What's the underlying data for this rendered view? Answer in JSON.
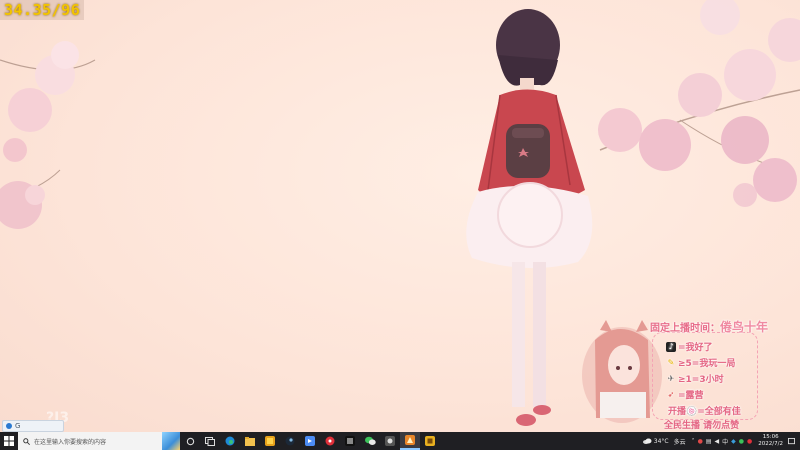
{
  "overlay_fps": "34.35/96",
  "toast": {
    "text": "G"
  },
  "ghost_mark": "?J3",
  "stream_overlay": {
    "title_prefix": "固定上播时间：",
    "title_highlight": "倦鸟十年",
    "lines": [
      {
        "icon": "tiktok-icon",
        "text": "=我好了"
      },
      {
        "icon": "pencil-icon",
        "text": "≥5=我玩一局"
      },
      {
        "icon": "plane-icon",
        "text": "≥1=3小时"
      },
      {
        "icon": "rocket-icon",
        "text": "=露营"
      }
    ],
    "gift_line": "开播🍥=全部有佳",
    "footer": "全民生播 请勿点赞"
  },
  "taskbar": {
    "search_placeholder": "在这里输入你要搜索的内容",
    "pinned": [
      "task-view-icon",
      "edge-icon",
      "file-explorer-icon",
      "steam-icon",
      "app-icon",
      "store-icon",
      "netease-music-icon",
      "app-icon",
      "wechat-icon",
      "app-icon",
      "app-icon"
    ],
    "active_index": 9,
    "weather": "34°C",
    "weather_desc": "多云",
    "ime": "中",
    "time": "15:06",
    "date": "2022/7/2"
  },
  "colors": {
    "accent": "#e46583",
    "fps": "#f2c400",
    "taskbar": "#1f1f23"
  }
}
